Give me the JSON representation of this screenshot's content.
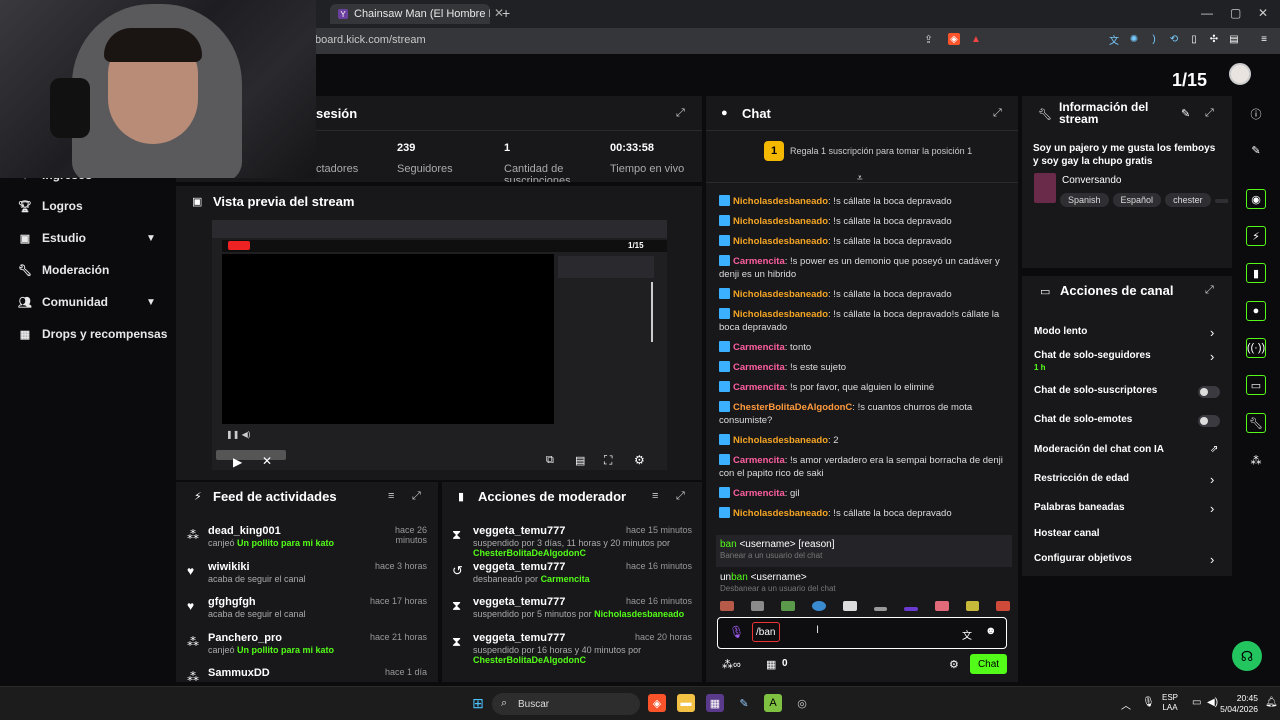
{
  "browser": {
    "tab_title": "Chainsaw Man (El Hombre Motosie...",
    "url": "board.kick.com/stream"
  },
  "header": {
    "page_counter": "1/15"
  },
  "sidebar": {
    "items": [
      {
        "label": "Ingresos",
        "icon": "money-icon"
      },
      {
        "label": "Logros",
        "icon": "trophy-icon"
      },
      {
        "label": "Estudio",
        "icon": "studio-icon"
      },
      {
        "label": "Moderación",
        "icon": "wrench-icon"
      },
      {
        "label": "Comunidad",
        "icon": "community-icon"
      },
      {
        "label": "Drops y recompensas",
        "icon": "gift-icon"
      }
    ]
  },
  "session": {
    "title": "sesión",
    "stats": [
      {
        "value": "",
        "label": "ctadores"
      },
      {
        "value": "239",
        "label": "Seguidores"
      },
      {
        "value": "1",
        "label": "Cantidad de suscripciones"
      },
      {
        "value": "00:33:58",
        "label": "Tiempo en vivo"
      }
    ]
  },
  "preview": {
    "title": "Vista previa del stream",
    "inner_counter": "1/15"
  },
  "feed": {
    "title": "Feed de actividades",
    "items": [
      {
        "name": "dead_king001",
        "pre": "canjeó ",
        "highlight": "Un pollito para mi kato",
        "time": "hace 26 minutos",
        "icon": "redeem-icon"
      },
      {
        "name": "wiwikiki",
        "pre": "acaba de seguir el canal",
        "highlight": "",
        "time": "hace 3 horas",
        "icon": "heart-icon"
      },
      {
        "name": "gfghgfgh",
        "pre": "acaba de seguir el canal",
        "highlight": "",
        "time": "hace 17 horas",
        "icon": "heart-icon"
      },
      {
        "name": "Panchero_pro",
        "pre": "canjeó ",
        "highlight": "Un pollito para mi kato",
        "time": "hace 21 horas",
        "icon": "redeem-icon"
      },
      {
        "name": "SammuxDD",
        "pre": "",
        "highlight": "",
        "time": "hace 1 día",
        "icon": "redeem-icon"
      }
    ]
  },
  "modactions": {
    "title": "Acciones de moderador",
    "items": [
      {
        "name": "veggeta_temu777",
        "pre": "suspendido por 3 días, 11 horas y 20 minutos por",
        "by": "ChesterBolitaDeAlgodonC",
        "time": "hace 15 minutos",
        "icon": "hourglass-icon"
      },
      {
        "name": "veggeta_temu777",
        "pre": "desbaneado por ",
        "by": "Carmencita",
        "time": "hace 16 minutos",
        "icon": "undo-icon"
      },
      {
        "name": "veggeta_temu777",
        "pre": "suspendido por 5 minutos por ",
        "by": "Nicholasdesbaneado",
        "time": "hace 16 minutos",
        "icon": "hourglass-icon"
      },
      {
        "name": "veggeta_temu777",
        "pre": "suspendido por 16 horas y 40 minutos por",
        "by": "ChesterBolitaDeAlgodonC",
        "time": "hace 20 horas",
        "icon": "hourglass-icon"
      }
    ]
  },
  "chat": {
    "title": "Chat",
    "gift_prompt": "Regala 1 suscripción para tomar la posición 1",
    "gift_rank": "1",
    "messages": [
      {
        "user": "Nicholasdesbaneado",
        "cls": "u-nick",
        "text": ": !s cállate la boca depravado"
      },
      {
        "user": "Nicholasdesbaneado",
        "cls": "u-nick",
        "text": ": !s cállate la boca depravado"
      },
      {
        "user": "Nicholasdesbaneado",
        "cls": "u-nick",
        "text": ": !s cállate la boca depravado"
      },
      {
        "user": "Carmencita",
        "cls": "u-carm",
        "text": ": !s power es un demonio que poseyó un cadáver y denji es un hibrido"
      },
      {
        "user": "Nicholasdesbaneado",
        "cls": "u-nick",
        "text": ": !s cállate la boca depravado"
      },
      {
        "user": "Nicholasdesbaneado",
        "cls": "u-nick",
        "text": ": !s cállate la boca depravado!s cállate la boca depravado"
      },
      {
        "user": "Carmencita",
        "cls": "u-carm",
        "text": ": tonto"
      },
      {
        "user": "Carmencita",
        "cls": "u-carm",
        "text": ": !s este sujeto"
      },
      {
        "user": "Carmencita",
        "cls": "u-carm",
        "text": ": !s por favor, que alguien lo eliminé"
      },
      {
        "user": "ChesterBolitaDeAlgodonC",
        "cls": "u-chest",
        "text": ": !s cuantos churros de mota consumiste?"
      },
      {
        "user": "Nicholasdesbaneado",
        "cls": "u-nick",
        "text": ": 2"
      },
      {
        "user": "Carmencita",
        "cls": "u-carm",
        "text": ": !s amor verdadero era la sempai borracha de denji con el papito rico de saki"
      },
      {
        "user": "Carmencita",
        "cls": "u-carm",
        "text": ": gil"
      },
      {
        "user": "Nicholasdesbaneado",
        "cls": "u-nick",
        "text": ": !s cállate la boca depravado"
      }
    ],
    "suggestions": [
      {
        "cmd_hl": "ban",
        "cmd_rest": " <username> [reason]",
        "desc": "Banear a un usuario del chat"
      },
      {
        "cmd_pre": "un",
        "cmd_hl": "ban",
        "cmd_rest": " <username>",
        "desc": "Desbanear a un usuario del chat"
      }
    ],
    "input_value": "/ban",
    "points": "0",
    "send_label": "Chat"
  },
  "streaminfo": {
    "title": "Información del stream",
    "description": "Soy un pajero y me gusta los femboys y soy gay la chupo gratis",
    "category": "Conversando",
    "tags": [
      "Spanish",
      "Español",
      "chester"
    ]
  },
  "channel_actions": {
    "title": "Acciones de canal",
    "items": [
      {
        "label": "Modo lento",
        "sub": "",
        "control": "chevron"
      },
      {
        "label": "Chat de solo-seguidores",
        "sub": "1 h",
        "control": "chevron"
      },
      {
        "label": "Chat de solo-suscriptores",
        "sub": "",
        "control": "toggle"
      },
      {
        "label": "Chat de solo-emotes",
        "sub": "",
        "control": "toggle"
      },
      {
        "label": "Moderación del chat con IA",
        "sub": "",
        "control": "external"
      },
      {
        "label": "Restricción de edad",
        "sub": "",
        "control": "chevron"
      },
      {
        "label": "Palabras baneadas",
        "sub": "",
        "control": "chevron"
      },
      {
        "label": "Hostear canal",
        "sub": "",
        "control": "none"
      },
      {
        "label": "Configurar objetivos",
        "sub": "",
        "control": "chevron"
      }
    ]
  },
  "taskbar": {
    "search_label": "Buscar",
    "lang_top": "ESP",
    "lang_bottom": "LAA",
    "time": "20:45",
    "date": "5/04/2026"
  },
  "watermark": "xom",
  "colors": {
    "accent": "#53fc18",
    "nick": "#f5a524",
    "carmencita": "#ff5fa0",
    "chester": "#ff9a3c",
    "panel": "#18181b",
    "background": "#0b0b0d"
  }
}
